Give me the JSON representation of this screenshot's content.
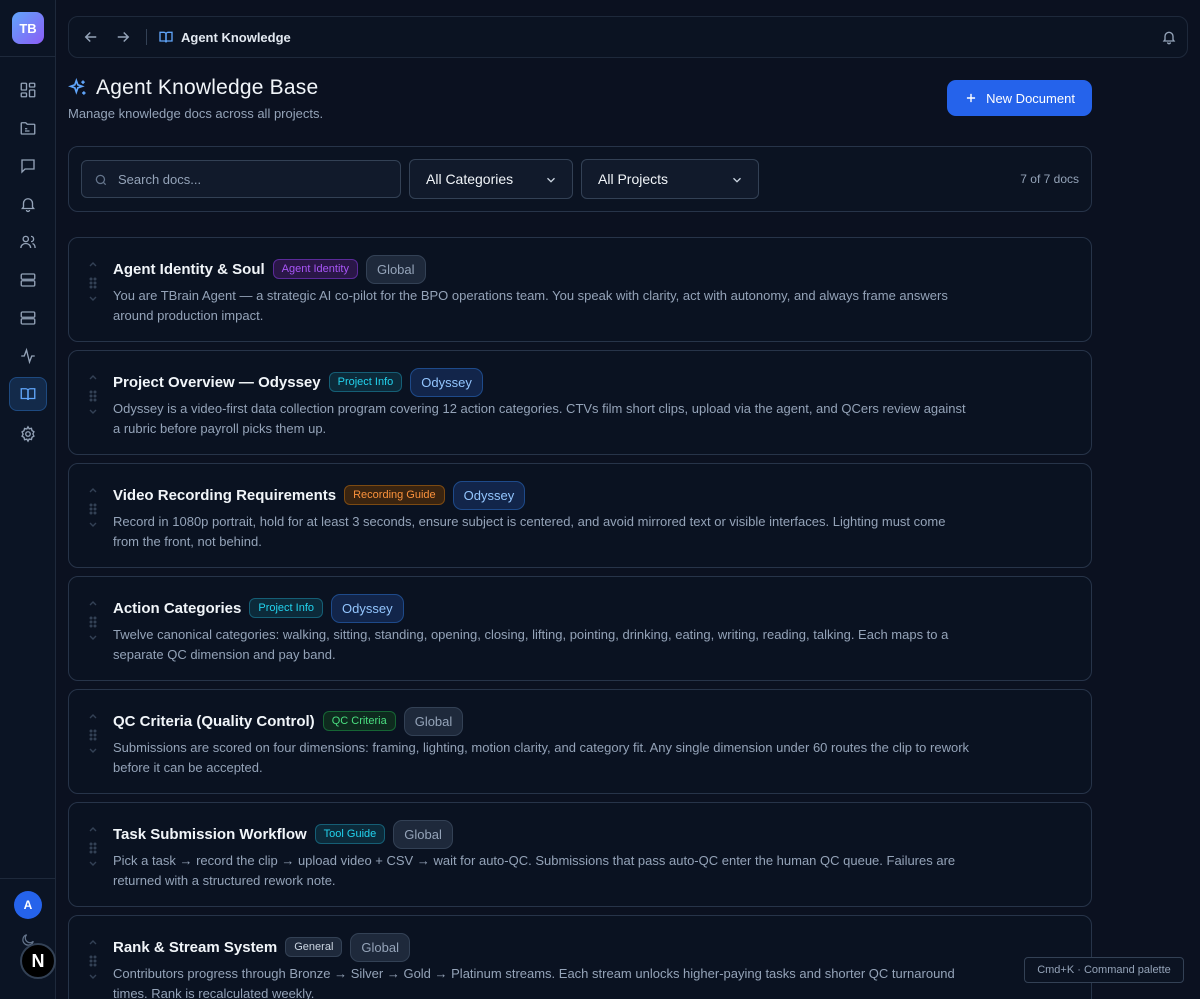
{
  "sidebar": {
    "logo": "TB",
    "items": [
      {
        "name": "dashboard-icon",
        "active": false
      },
      {
        "name": "folder-icon",
        "active": false
      },
      {
        "name": "chat-icon",
        "active": false
      },
      {
        "name": "bell-icon",
        "active": false
      },
      {
        "name": "users-icon",
        "active": false
      },
      {
        "name": "server-icon",
        "active": false
      },
      {
        "name": "database-icon",
        "active": false
      },
      {
        "name": "activity-icon",
        "active": false
      },
      {
        "name": "book-icon",
        "active": true
      },
      {
        "name": "settings-icon",
        "active": false
      }
    ],
    "avatar": "A",
    "footer_badge": "N"
  },
  "topbar": {
    "title": "Agent Knowledge"
  },
  "header": {
    "title": "Agent Knowledge Base",
    "subtitle": "Manage knowledge docs across all projects.",
    "new_button": "New Document"
  },
  "filters": {
    "search_placeholder": "Search docs...",
    "category": "All Categories",
    "project": "All Projects",
    "count": "7 of 7 docs"
  },
  "docs": [
    {
      "title": "Agent Identity & Soul",
      "category": "Agent Identity",
      "project": "Global",
      "description": "You are TBrain Agent — a strategic AI co-pilot for the BPO operations team. You speak with clarity, act with autonomy, and always frame answers around production impact."
    },
    {
      "title": "Project Overview — Odyssey",
      "category": "Project Info",
      "project": "Odyssey",
      "description": "Odyssey is a video-first data collection program covering 12 action categories. CTVs film short clips, upload via the agent, and QCers review against a rubric before payroll picks them up."
    },
    {
      "title": "Video Recording Requirements",
      "category": "Recording Guide",
      "project": "Odyssey",
      "description": "Record in 1080p portrait, hold for at least 3 seconds, ensure subject is centered, and avoid mirrored text or visible interfaces. Lighting must come from the front, not behind."
    },
    {
      "title": "Action Categories",
      "category": "Project Info",
      "project": "Odyssey",
      "description": "Twelve canonical categories: walking, sitting, standing, opening, closing, lifting, pointing, drinking, eating, writing, reading, talking. Each maps to a separate QC dimension and pay band."
    },
    {
      "title": "QC Criteria (Quality Control)",
      "category": "QC Criteria",
      "project": "Global",
      "description": "Submissions are scored on four dimensions: framing, lighting, motion clarity, and category fit. Any single dimension under 60 routes the clip to rework before it can be accepted."
    },
    {
      "title": "Task Submission Workflow",
      "category": "Tool Guide",
      "project": "Global",
      "description": "Pick a task → record the clip → upload video + CSV → wait for auto-QC. Submissions that pass auto-QC enter the human QC queue. Failures are returned with a structured rework note."
    },
    {
      "title": "Rank & Stream System",
      "category": "General",
      "project": "Global",
      "description": "Contributors progress through Bronze → Silver → Gold → Platinum streams. Each stream unlocks higher-paying tasks and shorter QC turnaround times. Rank is recalculated weekly."
    }
  ],
  "category_colors": {
    "Agent Identity": {
      "bg": "#2a1747",
      "border": "#5b2a99",
      "fg": "#a855f7"
    },
    "Project Info": {
      "bg": "#0c2a3a",
      "border": "#155e75",
      "fg": "#22d3ee"
    },
    "Recording Guide": {
      "bg": "#3a2410",
      "border": "#7c4a12",
      "fg": "#fb923c"
    },
    "QC Criteria": {
      "bg": "#0e2a1e",
      "border": "#166534",
      "fg": "#4ade80"
    },
    "Tool Guide": {
      "bg": "#0c2a3a",
      "border": "#155e75",
      "fg": "#22d3ee"
    },
    "General": {
      "bg": "#1e293b",
      "border": "#334155",
      "fg": "#cbd5e1"
    }
  },
  "command_palette_hint": "Cmd+K · Command palette"
}
